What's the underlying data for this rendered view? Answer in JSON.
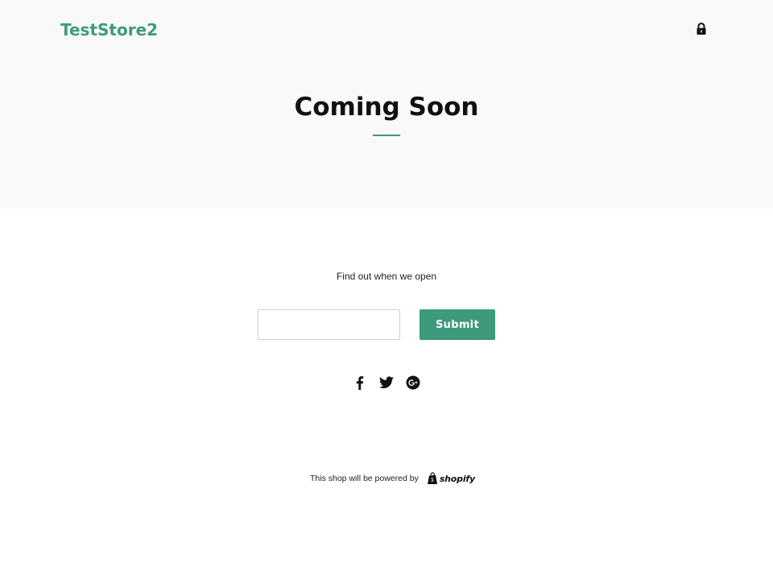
{
  "header": {
    "store_name": "TestStore2",
    "lock_icon": "lock-icon",
    "brand_color": "#3d9a7c"
  },
  "hero": {
    "title": "Coming Soon",
    "background": "#f9f9f9"
  },
  "signup": {
    "label": "Find out when we open",
    "email_value": "",
    "email_placeholder": "",
    "submit_label": "Submit",
    "button_color": "#3d9a7c"
  },
  "social": {
    "items": [
      {
        "name": "facebook",
        "icon": "facebook-icon"
      },
      {
        "name": "twitter",
        "icon": "twitter-icon"
      },
      {
        "name": "google-plus",
        "icon": "google-plus-icon"
      }
    ]
  },
  "footer": {
    "powered_by": "This shop will be powered by",
    "platform_logo_text": "shopify"
  }
}
